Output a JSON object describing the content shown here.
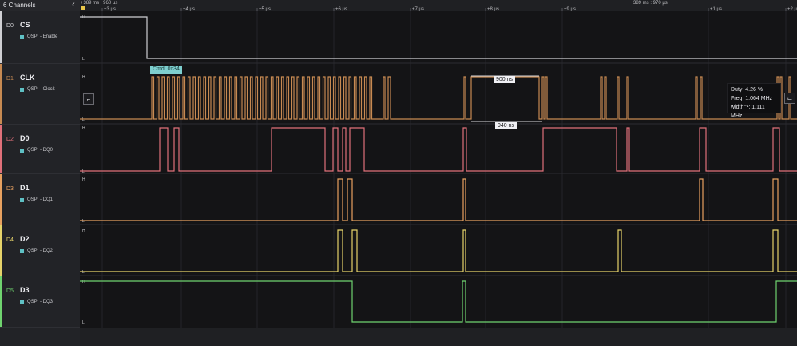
{
  "sidebar": {
    "channels_count": "6 Channels",
    "collapse_icon": "chevron-left-icon",
    "channels": [
      {
        "num": "D0",
        "name": "CS",
        "proto": "QSPI - Enable",
        "color": "#cfcfd3"
      },
      {
        "num": "D1",
        "name": "CLK",
        "proto": "QSPI - Clock",
        "color": "#c78a52"
      },
      {
        "num": "D2",
        "name": "D0",
        "proto": "QSPI - DQ0",
        "color": "#e0707a"
      },
      {
        "num": "D3",
        "name": "D1",
        "proto": "QSPI - DQ1",
        "color": "#e8a160"
      },
      {
        "num": "D4",
        "name": "D2",
        "proto": "QSPI - DQ2",
        "color": "#e6d36a"
      },
      {
        "num": "D5",
        "name": "D3",
        "proto": "QSPI - DQ3",
        "color": "#6fd36f"
      }
    ]
  },
  "timeline": {
    "left_marker": "+389 ms : 960 µs",
    "mid_marker": "389 ms : 970 µs",
    "ticks": [
      "+3 µs",
      "+4 µs",
      "+5 µs",
      "+6 µs",
      "+7 µs",
      "+8 µs",
      "+9 µs",
      "+1 µs",
      "+2 µs"
    ]
  },
  "levels": {
    "high": "H",
    "low": "L"
  },
  "annotations": {
    "cmd": "Cmd: 0x34",
    "meas_top": "900 ns",
    "meas_bottom": "940 ns"
  },
  "tooltip": {
    "duty": "Duty: 4.26 %",
    "freq": "Freq: 1.064 MHz",
    "width": "width⁻¹: 1.111 MHz"
  },
  "buttons": {
    "falling_edge_icon": "falling-edge-icon",
    "rising_edge_icon": "rising-edge-icon"
  }
}
